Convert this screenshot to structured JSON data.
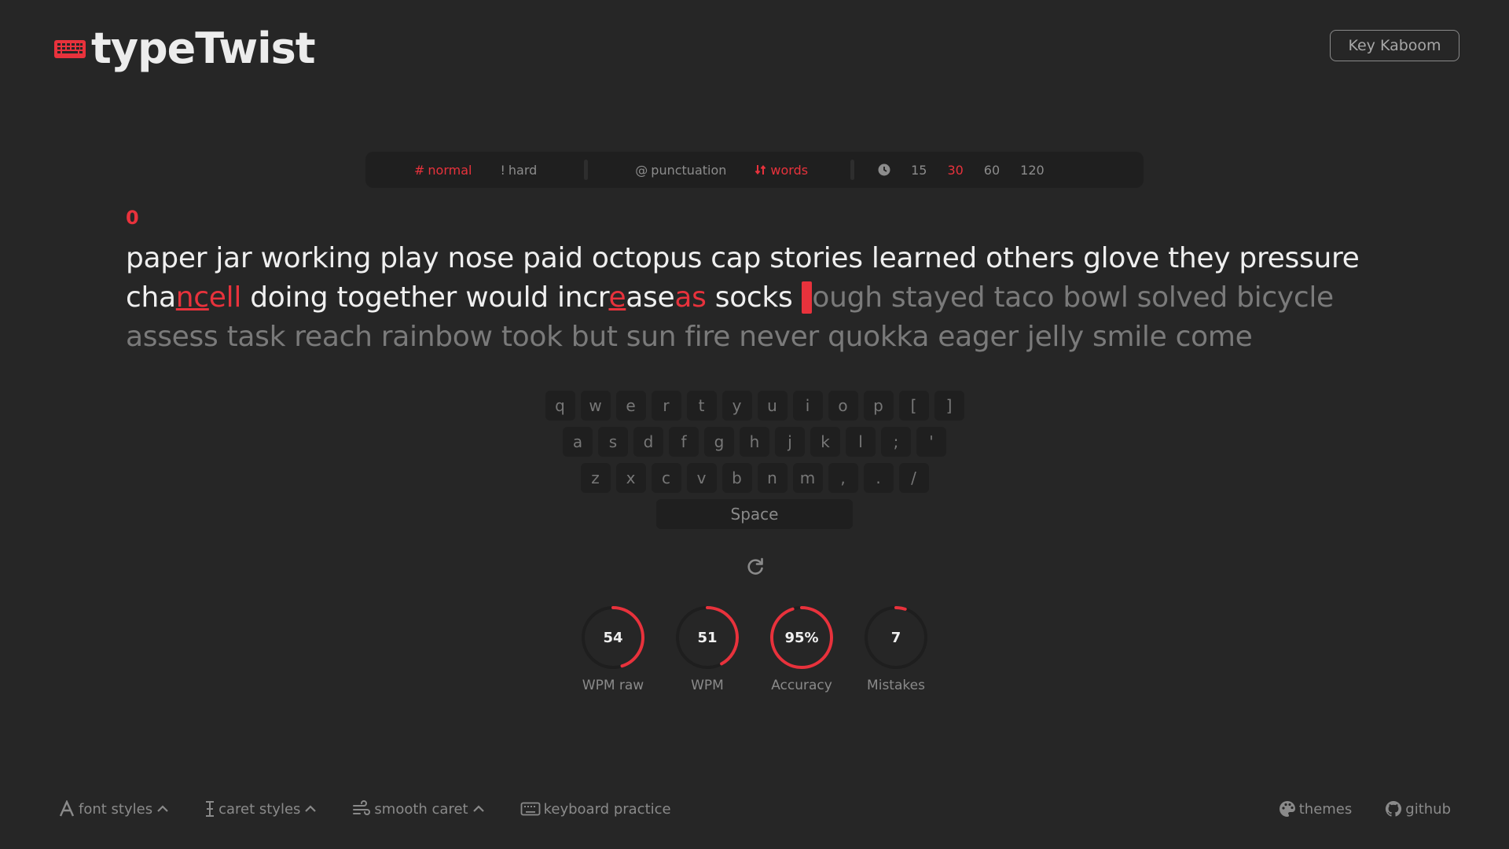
{
  "app": {
    "name": "typeTwist",
    "accent": "#e8323c",
    "background": "#262626"
  },
  "header": {
    "top_button_label": "Key Kaboom"
  },
  "config": {
    "difficulty": [
      {
        "icon": "#",
        "label": "normal",
        "active": true
      },
      {
        "icon": "!",
        "label": "hard",
        "active": false
      }
    ],
    "modes": [
      {
        "icon": "@",
        "label": "punctuation",
        "active": false
      },
      {
        "icon": "sort-icon",
        "label": "words",
        "active": true
      }
    ],
    "time_options": [
      "15",
      "30",
      "60",
      "120"
    ],
    "time_selected": "30"
  },
  "test": {
    "counter": "0",
    "line1": "paper jar working play nose paid octopus cap stories learned others glove they pressure",
    "line2_typed": {
      "w1a": "cha",
      "w1b": "nc",
      "w1c": "ell",
      "w2": "doing",
      "w3": "together",
      "w4": "would",
      "w5a": "incr",
      "w5b": "e",
      "w5c": "ase",
      "w5d": "as",
      "w6": "socks"
    },
    "caret_char": "t",
    "line2_rest": "ough stayed taco bowl solved bicycle",
    "line3": "assess task reach rainbow took but sun fire never quokka eager jelly smile come"
  },
  "keyboard": {
    "row1": [
      "q",
      "w",
      "e",
      "r",
      "t",
      "y",
      "u",
      "i",
      "o",
      "p",
      "[",
      "]"
    ],
    "row2": [
      "a",
      "s",
      "d",
      "f",
      "g",
      "h",
      "j",
      "k",
      "l",
      ";",
      "'"
    ],
    "row3": [
      "z",
      "x",
      "c",
      "v",
      "b",
      "n",
      "m",
      ",",
      ".",
      "/"
    ],
    "space_label": "Space"
  },
  "stats": [
    {
      "value": "54",
      "label": "WPM raw",
      "fraction": 0.45
    },
    {
      "value": "51",
      "label": "WPM",
      "fraction": 0.42
    },
    {
      "value": "95%",
      "label": "Accuracy",
      "fraction": 0.95
    },
    {
      "value": "7",
      "label": "Mistakes",
      "fraction": 0.05
    }
  ],
  "footer": {
    "font_styles": "font styles",
    "caret_styles": "caret styles",
    "smooth_caret": "smooth caret",
    "keyboard_practice": "keyboard practice",
    "themes": "themes",
    "github": "github"
  }
}
